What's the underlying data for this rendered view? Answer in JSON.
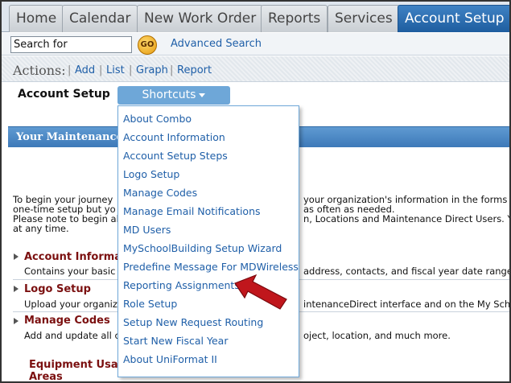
{
  "tabs": [
    {
      "label": "Home",
      "active": false
    },
    {
      "label": "Calendar",
      "active": false
    },
    {
      "label": "New Work Order",
      "active": false
    },
    {
      "label": "Reports",
      "active": false
    },
    {
      "label": "Services",
      "active": false
    },
    {
      "label": "Account Setup",
      "active": true
    }
  ],
  "search": {
    "value": "Search for",
    "go_label": "GO",
    "advanced_label": "Advanced Search"
  },
  "actions": {
    "label": "Actions:",
    "links": [
      "Add",
      "List",
      "Graph",
      "Report"
    ]
  },
  "page": {
    "title": "Account Setup",
    "shortcuts_label": "Shortcuts"
  },
  "section": {
    "title": "Your MaintenanceDi"
  },
  "intro": {
    "line1a": "To begin your journey",
    "line1b": "your organization's information in the forms b",
    "line2a": "one-time setup but yo",
    "line2b": "as often as needed.",
    "line3a": "Please note to begin al",
    "line3b": "n, Locations and Maintenance Direct Users. Yo",
    "line4": "at any time."
  },
  "items": [
    {
      "title": "Account Informat",
      "desc_a": "Contains your basic",
      "desc_b": "address, contacts, and fiscal year date range"
    },
    {
      "title": "Logo Setup",
      "desc_a": "Upload your organiz",
      "desc_b": "intenanceDirect interface and on the My Scho"
    },
    {
      "title": "Manage Codes",
      "desc_a": "Add and update all c",
      "desc_b": "oject, location, and much more."
    }
  ],
  "subsection": {
    "line1": "Equipment Usag",
    "line2": "Areas"
  },
  "menu": [
    "About Combo",
    "Account Information",
    "Account Setup Steps",
    "Logo Setup",
    "Manage Codes",
    "Manage Email Notifications",
    "MD Users",
    "MySchoolBuilding Setup Wizard",
    "Predefine Message For MDWireless",
    "Reporting Assignments",
    "Role Setup",
    "Setup New Request Routing",
    "Start New Fiscal Year",
    "About UniFormat II"
  ],
  "colors": {
    "accent": "#1e5d9f",
    "link": "#1f5fa8",
    "arrow": "#c0161c",
    "heading": "#7b1010"
  }
}
